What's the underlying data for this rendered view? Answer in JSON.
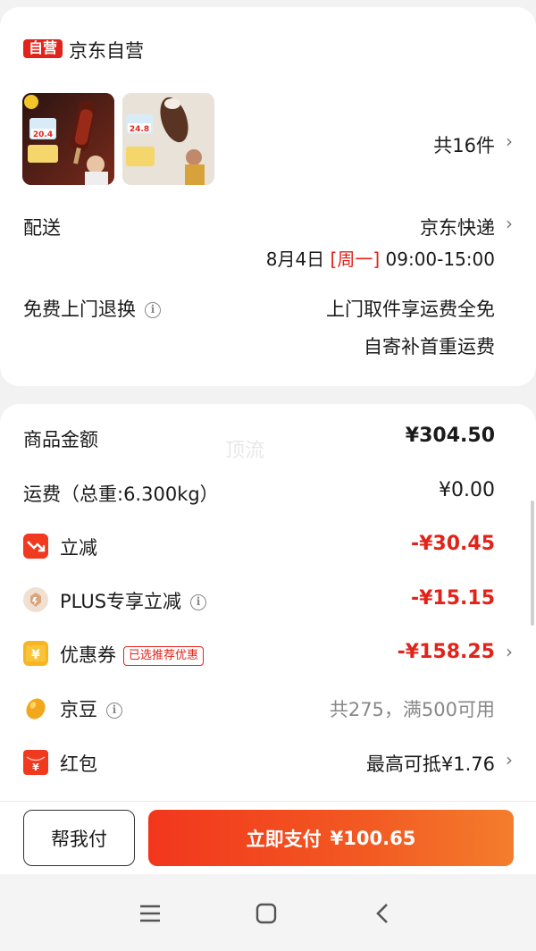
{
  "store": {
    "badge": "自营",
    "name": "京东自营"
  },
  "products": {
    "count_label": "共16件",
    "thumb1_price": "20.4",
    "thumb2_price": "24.8"
  },
  "delivery": {
    "label": "配送",
    "carrier": "京东快递",
    "date": "8月4日",
    "weekday": "[周一]",
    "time": "09:00-15:00"
  },
  "returns": {
    "label": "免费上门退换",
    "line1": "上门取件享运费全免",
    "line2": "自寄补首重运费"
  },
  "summary": {
    "watermark": "顶流",
    "goods_label": "商品金额",
    "goods_value": "¥304.50",
    "shipping_label": "运费（总重:6.300kg）",
    "shipping_value": "¥0.00",
    "discount_label": "立减",
    "discount_value": "-¥30.45",
    "plus_label": "PLUS专享立减",
    "plus_value": "-¥15.15",
    "coupon_label": "优惠券",
    "coupon_tag": "已选推荐优惠",
    "coupon_value": "-¥158.25",
    "beans_label": "京豆",
    "beans_value": "共275，满500可用",
    "redpacket_label": "红包",
    "redpacket_value": "最高可抵¥1.76"
  },
  "actions": {
    "help_pay": "帮我付",
    "pay_label": "立即支付",
    "pay_amount": "¥100.65"
  },
  "colors": {
    "accent": "#e2231a",
    "pay_start": "#f2361d",
    "pay_end": "#f47d2d"
  },
  "icons": {
    "chevron": "chevron-right-icon",
    "info": "info-icon",
    "discount": "trend-down-icon",
    "plus": "plus-badge-icon",
    "coupon": "coupon-yen-icon",
    "beans": "jd-bean-icon",
    "redpacket": "red-packet-icon"
  }
}
